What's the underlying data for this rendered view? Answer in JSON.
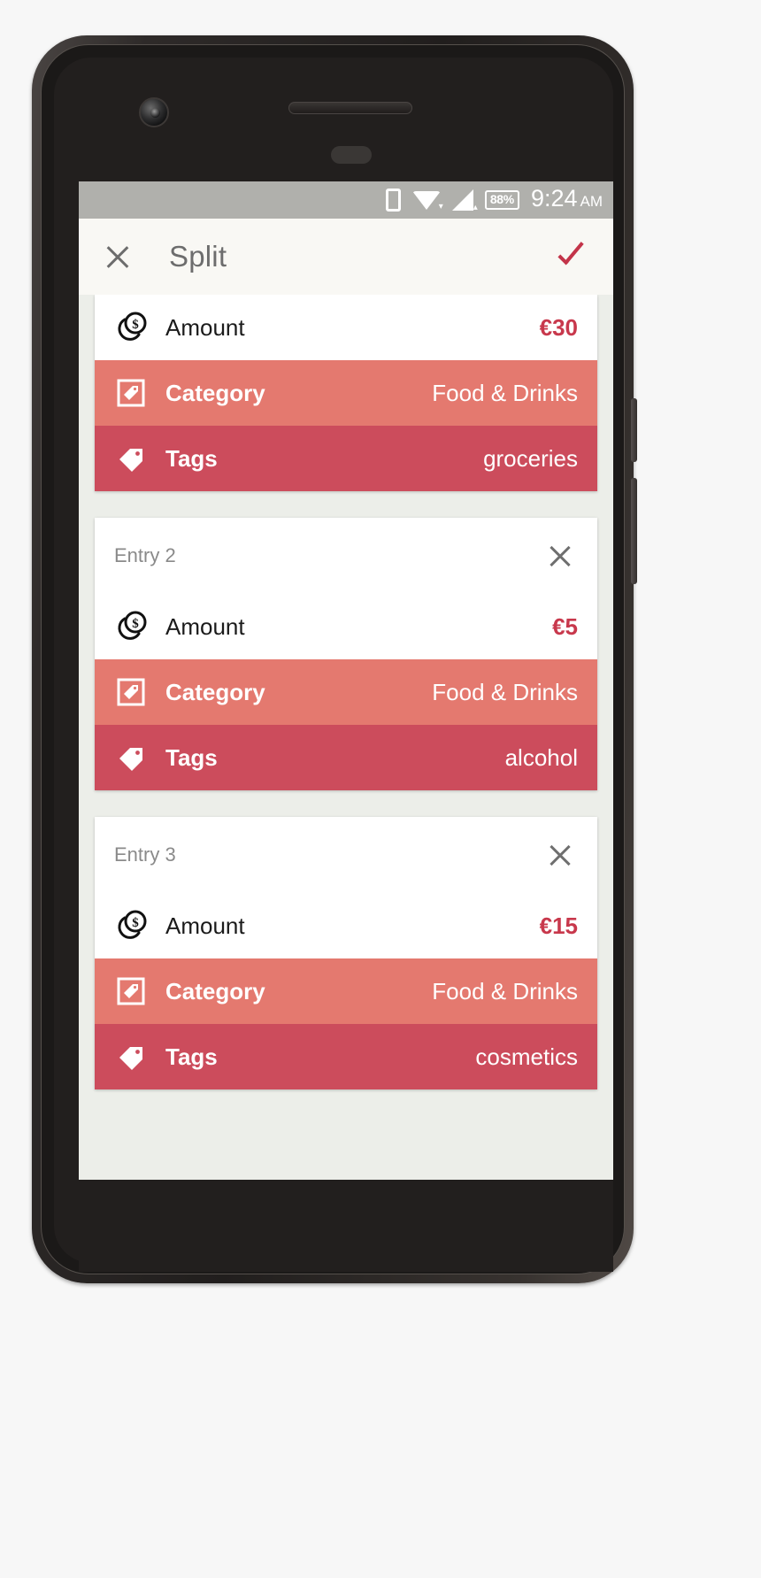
{
  "statusbar": {
    "battery": "88%",
    "time": "9:24",
    "ampm": "AM",
    "icons": [
      "sim-card-icon",
      "wifi-icon",
      "cellular-signal-icon",
      "battery-icon"
    ],
    "bg_color": "#b0b0ac"
  },
  "appbar": {
    "close_label": "close-icon",
    "title": "Split",
    "confirm_label": "check-icon",
    "bg_color": "#f9f8f4",
    "title_color": "#6d6d6d",
    "accent_color": "#c33449"
  },
  "colors": {
    "amount_value": "#c8384c",
    "category_row": "#e4796f",
    "tags_row": "#cc4c5c",
    "page_bg": "#eceee9"
  },
  "labels": {
    "amount": "Amount",
    "category": "Category",
    "tags": "Tags"
  },
  "entries": [
    {
      "header": null,
      "close": null,
      "amount": "€30",
      "category": "Food & Drinks",
      "tags": "groceries"
    },
    {
      "header": "Entry 2",
      "close": "close-icon",
      "amount": "€5",
      "category": "Food & Drinks",
      "tags": "alcohol"
    },
    {
      "header": "Entry 3",
      "close": "close-icon",
      "amount": "€15",
      "category": "Food & Drinks",
      "tags": "cosmetics"
    }
  ]
}
